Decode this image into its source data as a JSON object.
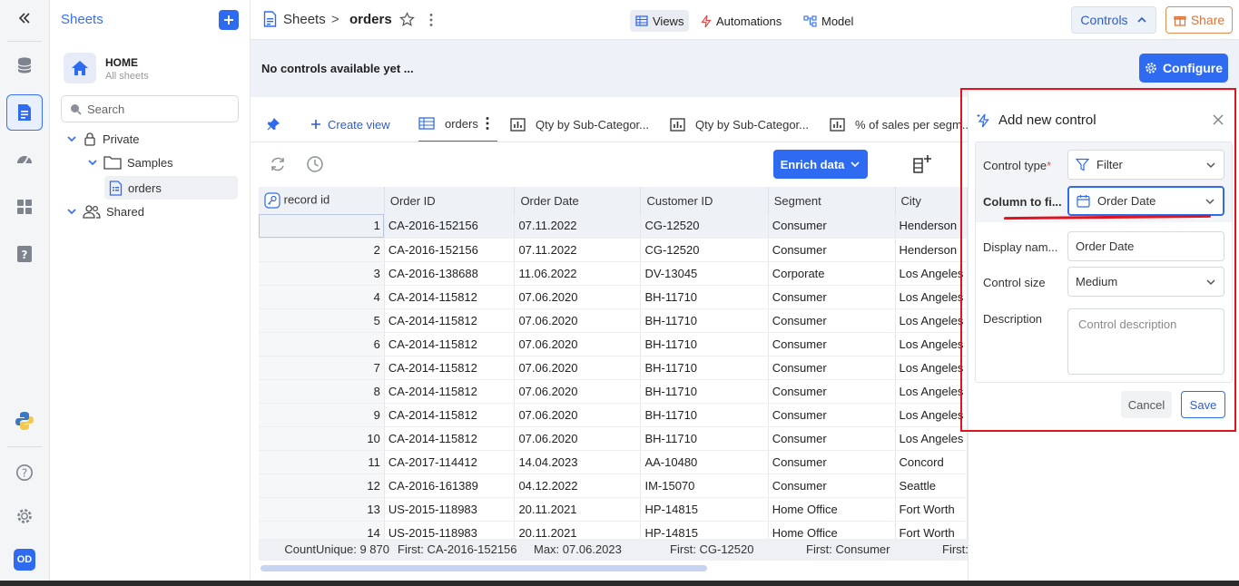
{
  "rail": {
    "user_initials": "OD"
  },
  "sidebar": {
    "title": "Sheets",
    "home": {
      "name": "HOME",
      "sub": "All sheets"
    },
    "search_placeholder": "Search",
    "tree": [
      {
        "label": "Private"
      },
      {
        "label": "Samples"
      },
      {
        "label": "orders"
      },
      {
        "label": "Shared"
      }
    ]
  },
  "topbar": {
    "crumb_root": "Sheets",
    "crumb_separator": ">",
    "crumb_current": "orders",
    "views": "Views",
    "automations": "Automations",
    "model": "Model",
    "controls": "Controls",
    "share": "Share"
  },
  "controls_bar": {
    "empty_text": "No controls available yet ...",
    "configure": "Configure"
  },
  "tabs": {
    "create_view": "Create view",
    "items": [
      "orders",
      "Qty by Sub-Categor...",
      "Qty by Sub-Categor...",
      "% of sales per segm..."
    ]
  },
  "toolbar": {
    "enrich": "Enrich data"
  },
  "grid": {
    "columns": [
      "record id",
      "Order ID",
      "Order Date",
      "Customer ID",
      "Segment",
      "City"
    ],
    "rows": [
      [
        "1",
        "CA-2016-152156",
        "07.11.2022",
        "CG-12520",
        "Consumer",
        "Henderson"
      ],
      [
        "2",
        "CA-2016-152156",
        "07.11.2022",
        "CG-12520",
        "Consumer",
        "Henderson"
      ],
      [
        "3",
        "CA-2016-138688",
        "11.06.2022",
        "DV-13045",
        "Corporate",
        "Los Angeles"
      ],
      [
        "4",
        "CA-2014-115812",
        "07.06.2020",
        "BH-11710",
        "Consumer",
        "Los Angeles"
      ],
      [
        "5",
        "CA-2014-115812",
        "07.06.2020",
        "BH-11710",
        "Consumer",
        "Los Angeles"
      ],
      [
        "6",
        "CA-2014-115812",
        "07.06.2020",
        "BH-11710",
        "Consumer",
        "Los Angeles"
      ],
      [
        "7",
        "CA-2014-115812",
        "07.06.2020",
        "BH-11710",
        "Consumer",
        "Los Angeles"
      ],
      [
        "8",
        "CA-2014-115812",
        "07.06.2020",
        "BH-11710",
        "Consumer",
        "Los Angeles"
      ],
      [
        "9",
        "CA-2014-115812",
        "07.06.2020",
        "BH-11710",
        "Consumer",
        "Los Angeles"
      ],
      [
        "10",
        "CA-2014-115812",
        "07.06.2020",
        "BH-11710",
        "Consumer",
        "Los Angeles"
      ],
      [
        "11",
        "CA-2017-114412",
        "14.04.2023",
        "AA-10480",
        "Consumer",
        "Concord"
      ],
      [
        "12",
        "CA-2016-161389",
        "04.12.2022",
        "IM-15070",
        "Consumer",
        "Seattle"
      ],
      [
        "13",
        "US-2015-118983",
        "20.11.2021",
        "HP-14815",
        "Home Office",
        "Fort Worth"
      ],
      [
        "14",
        "US-2015-118983",
        "20.11.2021",
        "HP-14815",
        "Home Office",
        "Fort Worth"
      ]
    ],
    "footer": [
      "CountUnique: 9 870",
      "First: CA-2016-152156",
      "Max: 07.06.2023",
      "First: CG-12520",
      "First: Consumer",
      "First: Henderson"
    ]
  },
  "panel": {
    "title": "Add new control",
    "control_type_label": "Control type",
    "required_mark": "*",
    "control_type_value": "Filter",
    "column_label": "Column to fi...",
    "column_value": "Order Date",
    "display_name_label": "Display nam...",
    "display_name_value": "Order Date",
    "control_size_label": "Control size",
    "control_size_value": "Medium",
    "description_label": "Description",
    "description_placeholder": "Control description",
    "cancel": "Cancel",
    "save": "Save"
  },
  "colors": {
    "accent": "#2f6bf0",
    "highlight": "#e0141e",
    "share": "#d8733a"
  }
}
